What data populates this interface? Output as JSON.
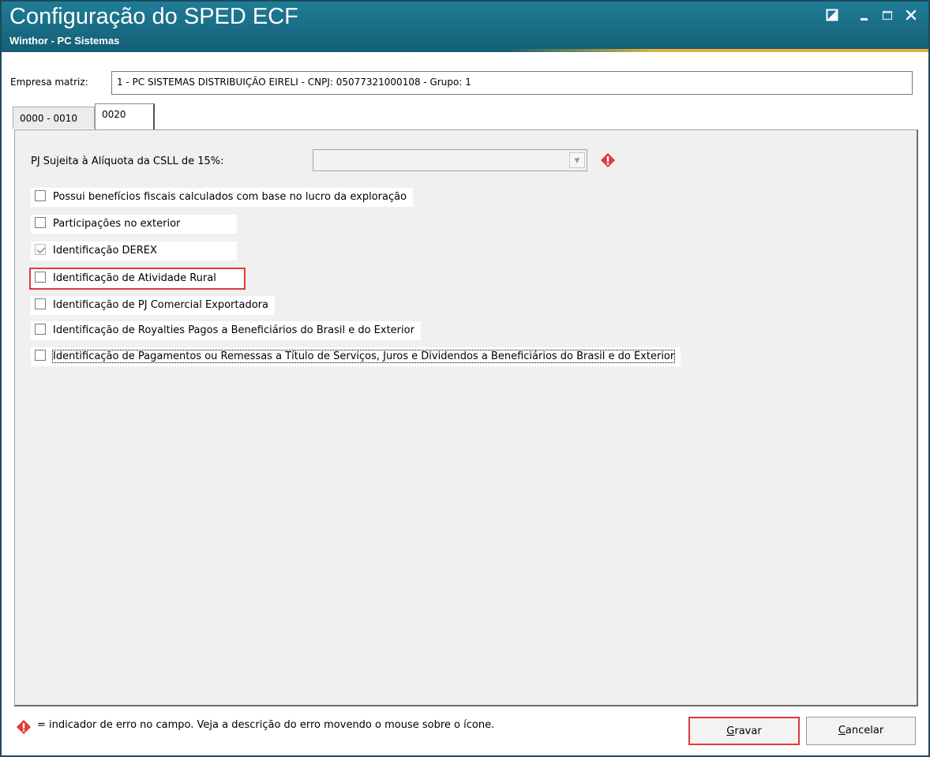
{
  "window": {
    "title": "Configuração do SPED ECF",
    "subtitle": "Winthor - PC Sistemas",
    "controls": [
      "restore-icon",
      "minimize-icon",
      "maximize-icon",
      "close-icon"
    ]
  },
  "empresa": {
    "label": "Empresa matriz:",
    "value": "1 - PC SISTEMAS DISTRIBUIÇÃO EIRELI - CNPJ: 05077321000108 - Grupo: 1"
  },
  "tabs": [
    {
      "label": "0000 - 0010",
      "active": false
    },
    {
      "label": "0020",
      "active": true
    }
  ],
  "form": {
    "pj_label": "PJ Sujeita à Alíquota da CSLL de 15%:",
    "pj_value": "",
    "checkboxes": [
      {
        "label": "Possui benefícios fiscais calculados com base no lucro da exploração",
        "checked": false,
        "disabled": false
      },
      {
        "label": "Participações no exterior",
        "checked": false,
        "disabled": false
      },
      {
        "label": "Identificação DEREX",
        "checked": true,
        "disabled": true
      },
      {
        "label": "Identificação de Atividade Rural",
        "checked": false,
        "disabled": false
      },
      {
        "label": "Identificação de PJ Comercial Exportadora",
        "checked": false,
        "disabled": false
      },
      {
        "label": "Identificação de Royalties Pagos a Beneficiários do Brasil e do Exterior",
        "checked": false,
        "disabled": false
      },
      {
        "label": "Identificação de Pagamentos ou Remessas a Título de Serviços, Juros e Dividendos a Beneficiários do Brasil e do Exterior",
        "checked": false,
        "disabled": false
      }
    ]
  },
  "legend": {
    "text": "= indicador de erro no campo. Veja a descrição do erro movendo o mouse sobre o ícone."
  },
  "buttons": {
    "save_accel": "G",
    "save_rest": "ravar",
    "cancel_accel": "C",
    "cancel_rest": "ancelar"
  },
  "colors": {
    "titlebar": "#1a6f87",
    "accent": "#e2b23c",
    "highlight": "#e03a3a",
    "error_icon": "#e03a3a"
  }
}
